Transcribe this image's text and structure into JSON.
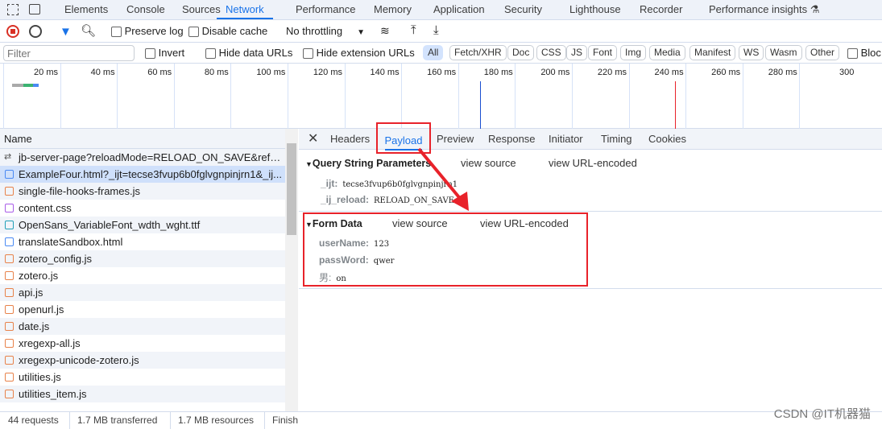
{
  "panel_tabs": [
    "Elements",
    "Console",
    "Sources",
    "Network",
    "Performance",
    "Memory",
    "Application",
    "Security",
    "Lighthouse",
    "Recorder",
    "Performance insights"
  ],
  "active_panel": "Network",
  "toolbar": {
    "preserve_log": "Preserve log",
    "disable_cache": "Disable cache",
    "throttling": "No throttling"
  },
  "filter": {
    "placeholder": "Filter",
    "invert": "Invert",
    "hide_data": "Hide data URLs",
    "hide_ext": "Hide extension URLs",
    "types": [
      "All",
      "Fetch/XHR",
      "Doc",
      "CSS",
      "JS",
      "Font",
      "Img",
      "Media",
      "Manifest",
      "WS",
      "Wasm",
      "Other"
    ],
    "blocked": "Bloc"
  },
  "timeline": {
    "ticks": [
      "20 ms",
      "40 ms",
      "60 ms",
      "80 ms",
      "100 ms",
      "120 ms",
      "140 ms",
      "160 ms",
      "180 ms",
      "200 ms",
      "220 ms",
      "240 ms",
      "260 ms",
      "280 ms",
      "300"
    ]
  },
  "requests": {
    "header": "Name",
    "selected_index": 1,
    "items": [
      {
        "name": "jb-server-page?reloadMode=RELOAD_ON_SAVE&referr...",
        "type": "other"
      },
      {
        "name": "ExampleFour.html?_ijt=tecse3fvup6b0fglvgnpinjrn1&_ij...",
        "type": "doc"
      },
      {
        "name": "single-file-hooks-frames.js",
        "type": "js"
      },
      {
        "name": "content.css",
        "type": "css"
      },
      {
        "name": "OpenSans_VariableFont_wdth_wght.ttf",
        "type": "font"
      },
      {
        "name": "translateSandbox.html",
        "type": "doc"
      },
      {
        "name": "zotero_config.js",
        "type": "js"
      },
      {
        "name": "zotero.js",
        "type": "js"
      },
      {
        "name": "api.js",
        "type": "js"
      },
      {
        "name": "openurl.js",
        "type": "js"
      },
      {
        "name": "date.js",
        "type": "js"
      },
      {
        "name": "xregexp-all.js",
        "type": "js"
      },
      {
        "name": "xregexp-unicode-zotero.js",
        "type": "js"
      },
      {
        "name": "utilities.js",
        "type": "js"
      },
      {
        "name": "utilities_item.js",
        "type": "js"
      }
    ]
  },
  "status": {
    "requests": "44 requests",
    "transferred": "1.7 MB transferred",
    "resources": "1.7 MB resources",
    "finish": "Finish"
  },
  "detail_tabs": [
    "Headers",
    "Payload",
    "Preview",
    "Response",
    "Initiator",
    "Timing",
    "Cookies"
  ],
  "active_detail": "Payload",
  "payload": {
    "query": {
      "title": "Query String Parameters",
      "view_source": "view source",
      "view_encoded": "view URL-encoded",
      "params": [
        {
          "key": "_ijt:",
          "value": "tecse3fvup6b0fglvgnpinjrn1"
        },
        {
          "key": "_ij_reload:",
          "value": "RELOAD_ON_SAVE"
        }
      ]
    },
    "form": {
      "title": "Form Data",
      "view_source": "view source",
      "view_encoded": "view URL-encoded",
      "params": [
        {
          "key": "userName:",
          "value": "123"
        },
        {
          "key": "passWord:",
          "value": "qwer"
        },
        {
          "key": "男:",
          "value": "on"
        }
      ]
    }
  },
  "watermark": "CSDN @IT机器猫",
  "colors": {
    "accent": "#1a73e8",
    "annotation": "#e8222a",
    "selected_row": "#cfe0fb"
  }
}
